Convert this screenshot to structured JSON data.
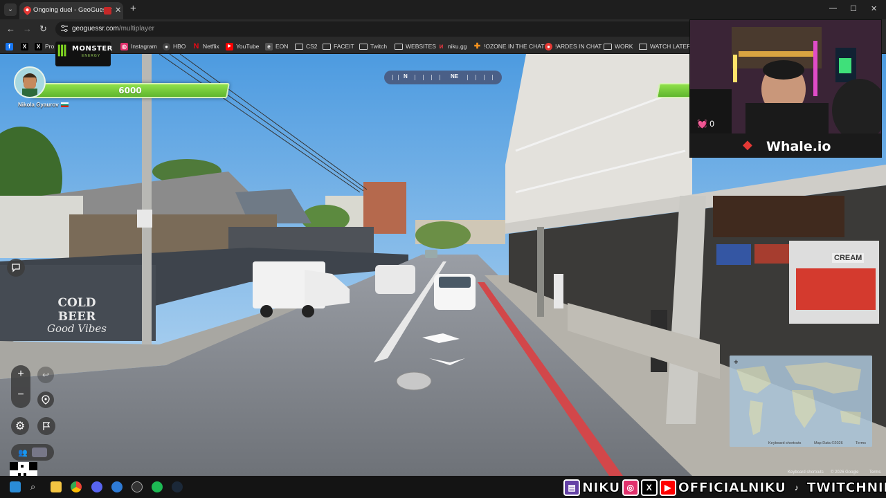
{
  "browser": {
    "tab_title": "Ongoing duel - GeoGuessr",
    "new_tab": "+",
    "url_host": "geoguessr.com",
    "url_path": "/multiplayer",
    "window_controls": [
      "—",
      "☐",
      "✕"
    ]
  },
  "bookmarks": [
    {
      "label": "",
      "icon": "facebook-icon",
      "color": "#1877f2"
    },
    {
      "label": "",
      "icon": "x-icon",
      "color": "#000000"
    },
    {
      "label": "Pro",
      "icon": "x-icon",
      "color": "#000000"
    },
    {
      "label": "Instagram",
      "icon": "instagram-icon",
      "color": "#e1306c"
    },
    {
      "label": "HBO",
      "icon": "hbo-icon",
      "color": "#444444"
    },
    {
      "label": "Netflix",
      "icon": "netflix-icon",
      "color": "#e50914"
    },
    {
      "label": "YouTube",
      "icon": "youtube-icon",
      "color": "#ff0000"
    },
    {
      "label": "EON",
      "icon": "eon-icon",
      "color": "#555555"
    },
    {
      "label": "CS2",
      "icon": "folder-icon",
      "color": ""
    },
    {
      "label": "FACEIT",
      "icon": "folder-icon",
      "color": ""
    },
    {
      "label": "Twitch",
      "icon": "folder-icon",
      "color": ""
    },
    {
      "label": "WEBSITES",
      "icon": "folder-icon",
      "color": ""
    },
    {
      "label": "niku.gg",
      "icon": "niku-icon",
      "color": "#d9363e"
    },
    {
      "label": "!OZONE IN THE CHAT",
      "icon": "ozone-icon",
      "color": "#f7931e"
    },
    {
      "label": "!ARDES IN CHAT",
      "icon": "ardes-icon",
      "color": "#e53935"
    },
    {
      "label": "WORK",
      "icon": "folder-icon",
      "color": ""
    },
    {
      "label": "WATCH LATER",
      "icon": "folder-icon",
      "color": ""
    }
  ],
  "game": {
    "sponsor": "MONSTER",
    "sponsor_sub": "ENERGY",
    "player_health": "6000",
    "player_name": "Nikola Gyaurov",
    "compass_labels": [
      "N",
      "NE"
    ],
    "zoom_in": "+",
    "zoom_out": "−"
  },
  "scene_text": {
    "wall_sign_line1": "COLD BEER",
    "wall_sign_line2": "Good Vibes",
    "shop_sign": "CREAM"
  },
  "minimap": {
    "attribution": "Keyboard shortcuts",
    "map_data": "Map Data ©2026",
    "terms": "Terms",
    "expand_icon": "+"
  },
  "streetview_attribution": {
    "shortcuts": "Keyboard shortcuts",
    "copyright": "© 2026 Google",
    "terms": "Terms"
  },
  "webcam": {
    "heart_rate": "0",
    "sponsor": "Whale.io"
  },
  "socials": {
    "twitch_name": "NIKU",
    "handle": "OFFICIALNIKU",
    "tiktok": "TWITCHNIKU"
  }
}
